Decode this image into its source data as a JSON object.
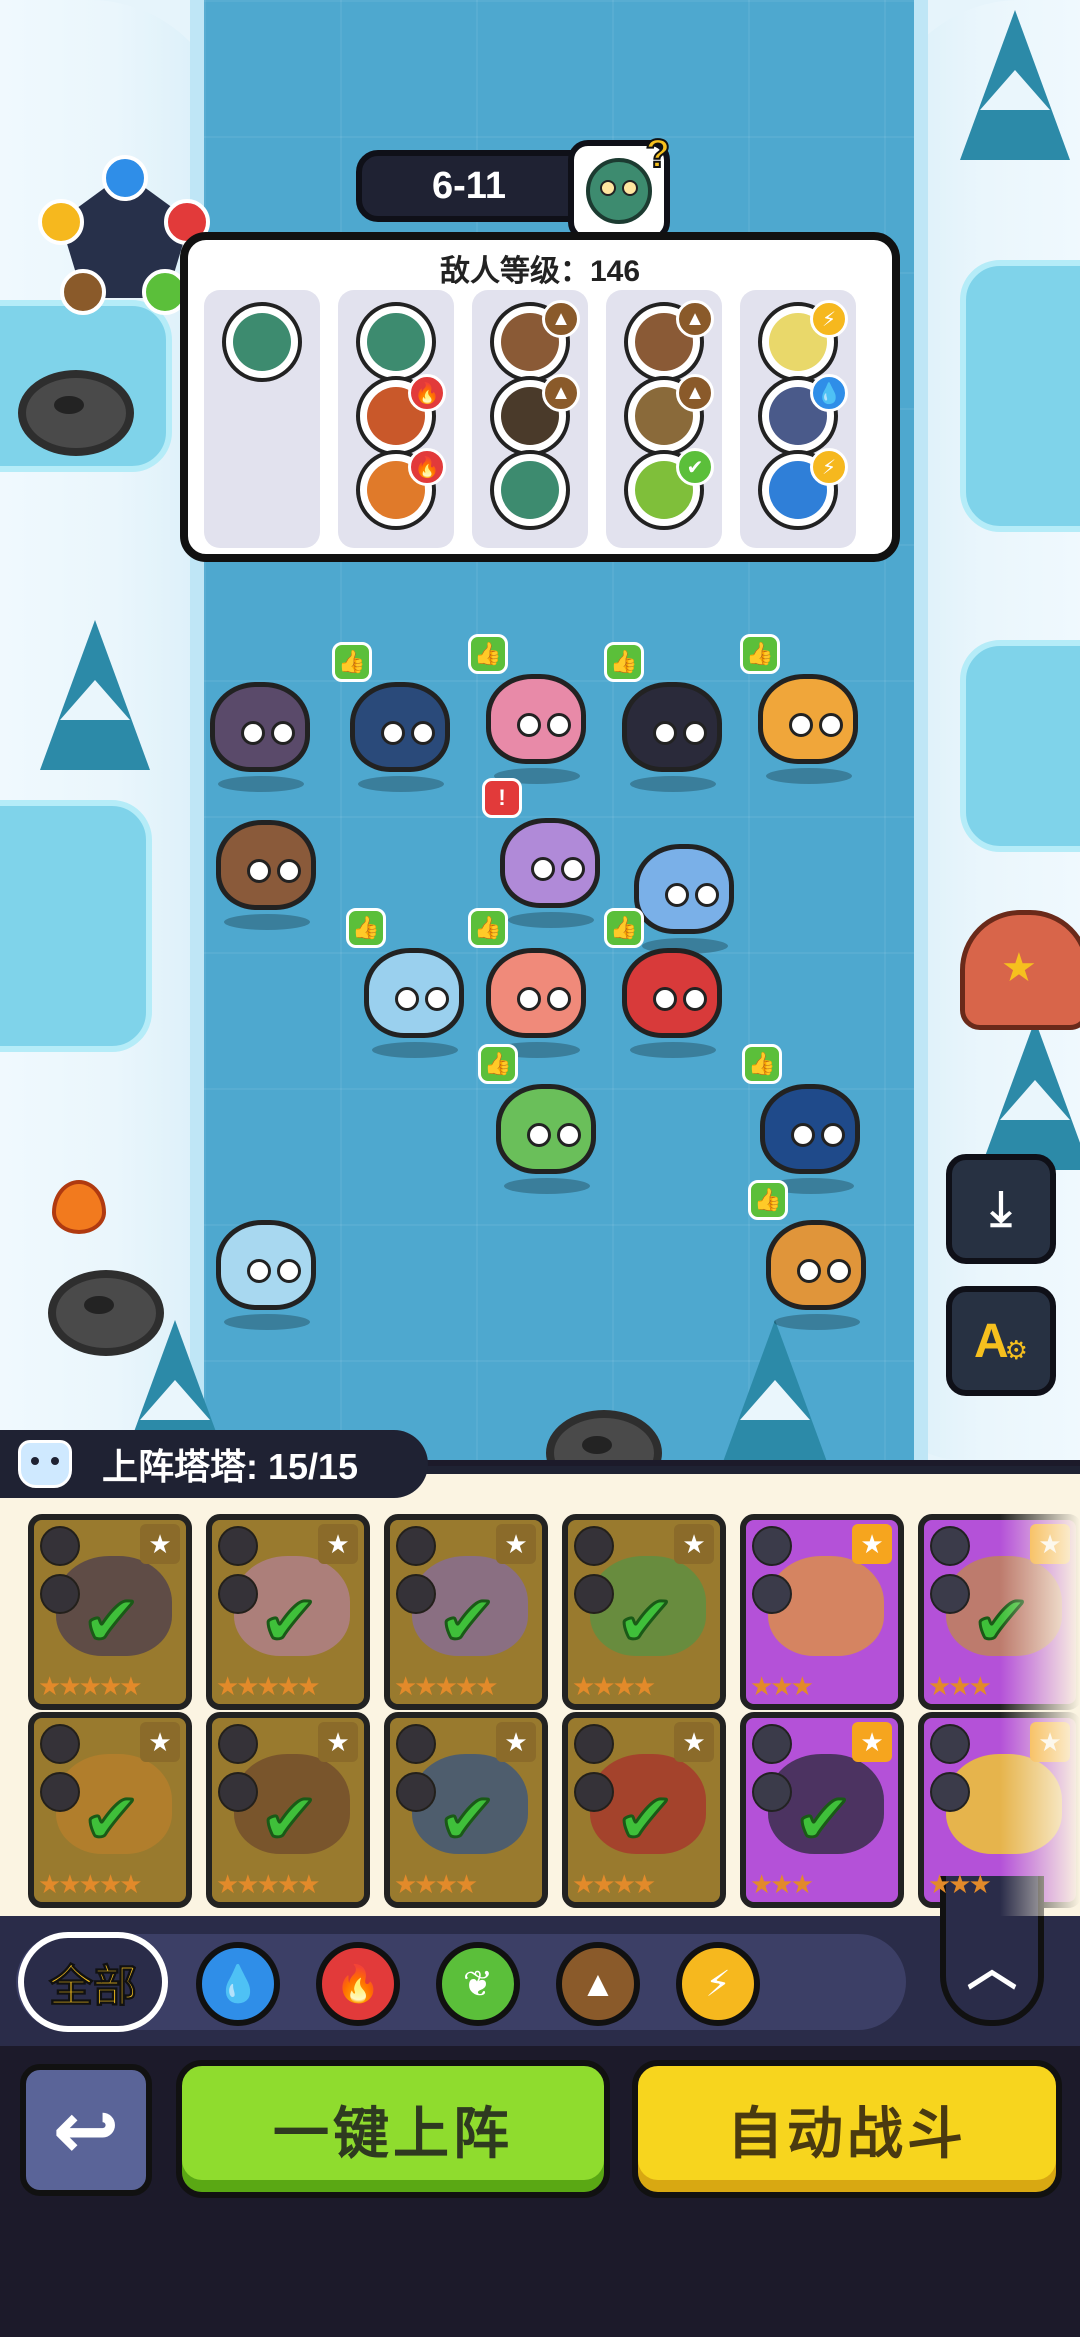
{
  "stage": {
    "label": "6-11",
    "boss_icon": "zombie-boss-icon"
  },
  "enemy_panel": {
    "title": "敌人等级：146",
    "waves": [
      {
        "enemies": [
          {
            "color": "#3d8b6f",
            "element": ""
          }
        ]
      },
      {
        "enemies": [
          {
            "color": "#3d8b6f",
            "element": ""
          },
          {
            "color": "#c9582a",
            "element": "fire"
          },
          {
            "color": "#e07a2a",
            "element": "fire"
          }
        ]
      },
      {
        "enemies": [
          {
            "color": "#8a5a36",
            "element": "earth"
          },
          {
            "color": "#4a3a2a",
            "element": "earth"
          },
          {
            "color": "#3d8b6f",
            "element": ""
          }
        ]
      },
      {
        "enemies": [
          {
            "color": "#8a5a36",
            "element": "earth"
          },
          {
            "color": "#8a6a3a",
            "element": "earth"
          },
          {
            "color": "#7fbf3a",
            "element": "grass"
          }
        ]
      },
      {
        "enemies": [
          {
            "color": "#e9d86a",
            "element": "thunder"
          },
          {
            "color": "#4a5a8a",
            "element": "water"
          },
          {
            "color": "#2f7fd8",
            "element": "thunder"
          }
        ]
      }
    ]
  },
  "element_wheel": [
    "water",
    "fire",
    "grass",
    "earth",
    "thunder"
  ],
  "elements": {
    "water": {
      "color": "#2f8ee8",
      "glyph": "💧"
    },
    "fire": {
      "color": "#e23a3a",
      "glyph": "🔥"
    },
    "grass": {
      "color": "#5bbf3a",
      "glyph": "✔"
    },
    "earth": {
      "color": "#8a5a2a",
      "glyph": "▲"
    },
    "thunder": {
      "color": "#f6b81e",
      "glyph": "⚡"
    }
  },
  "board_units": [
    {
      "name": "dino-unit",
      "color": "#5a4a6a",
      "thumb": ""
    },
    {
      "name": "penguin-unit",
      "color": "#2a4a7a",
      "thumb": "up"
    },
    {
      "name": "mantis-unit",
      "color": "#e88aa8",
      "thumb": "up"
    },
    {
      "name": "dog-unit",
      "color": "#2a2a3a",
      "thumb": "up"
    },
    {
      "name": "lion-unit",
      "color": "#f0a63a",
      "thumb": "up"
    },
    {
      "name": "ferret-unit",
      "color": "#8a5a3a",
      "thumb": ""
    },
    {
      "name": "dragon-unit",
      "color": "#b08ad8",
      "thumb": "down"
    },
    {
      "name": "blob-unit",
      "color": "#7ab0e8",
      "thumb": ""
    },
    {
      "name": "fish-unit",
      "color": "#9ad0ee",
      "thumb": "up"
    },
    {
      "name": "flower-unit",
      "color": "#f08a7a",
      "thumb": "up"
    },
    {
      "name": "firebird-unit",
      "color": "#d83a3a",
      "thumb": "up"
    },
    {
      "name": "bird-unit",
      "color": "#1f4a8a",
      "thumb": "up"
    },
    {
      "name": "cat-plant-unit",
      "color": "#6abf5a",
      "thumb": "up"
    },
    {
      "name": "seal-unit",
      "color": "#a8d8f0",
      "thumb": ""
    },
    {
      "name": "fox-unit",
      "color": "#e0953a",
      "thumb": "up"
    }
  ],
  "side_buttons": {
    "download_icon": "⤓",
    "auto_label": "A",
    "gear_icon": "⚙"
  },
  "roster": {
    "label": "上阵塔塔: 15/15",
    "cards": [
      {
        "style": "gold",
        "color": "#5a4a6a",
        "deployed": true,
        "stars": "★★★★★"
      },
      {
        "style": "gold",
        "color": "#e8a8c8",
        "deployed": true,
        "stars": "★★★★★"
      },
      {
        "style": "gold",
        "color": "#a88ad8",
        "deployed": true,
        "stars": "★★★★★"
      },
      {
        "style": "gold",
        "color": "#6abf5a",
        "deployed": true,
        "stars": "★★★★"
      },
      {
        "style": "purple",
        "color": "#e0953a",
        "deployed": false,
        "stars": "★★★"
      },
      {
        "style": "purple",
        "color": "#c08a4a",
        "deployed": true,
        "stars": "★★★"
      },
      {
        "style": "gold",
        "color": "#f0a63a",
        "deployed": true,
        "stars": "★★★★★"
      },
      {
        "style": "gold",
        "color": "#8a5a3a",
        "deployed": true,
        "stars": "★★★★★"
      },
      {
        "style": "gold",
        "color": "#3a6ab0",
        "deployed": true,
        "stars": "★★★★"
      },
      {
        "style": "gold",
        "color": "#d83a3a",
        "deployed": true,
        "stars": "★★★★"
      },
      {
        "style": "purple",
        "color": "#2a2a3a",
        "deployed": true,
        "stars": "★★★"
      },
      {
        "style": "purple",
        "color": "#f7d51e",
        "deployed": false,
        "stars": "★★★"
      }
    ]
  },
  "filter": {
    "all_label": "全部",
    "buttons": [
      {
        "name": "filter-water-button",
        "color": "#2f8ee8",
        "glyph": "💧"
      },
      {
        "name": "filter-fire-button",
        "color": "#e23a3a",
        "glyph": "🔥"
      },
      {
        "name": "filter-grass-button",
        "color": "#5bbf3a",
        "glyph": "❦"
      },
      {
        "name": "filter-earth-button",
        "color": "#8a5a2a",
        "glyph": "▲"
      },
      {
        "name": "filter-thunder-button",
        "color": "#f6b81e",
        "glyph": "⚡"
      }
    ],
    "collapse_glyph": "︿"
  },
  "actions": {
    "back_glyph": "↩",
    "deploy_label": "一键上阵",
    "auto_battle_label": "自动战斗"
  }
}
